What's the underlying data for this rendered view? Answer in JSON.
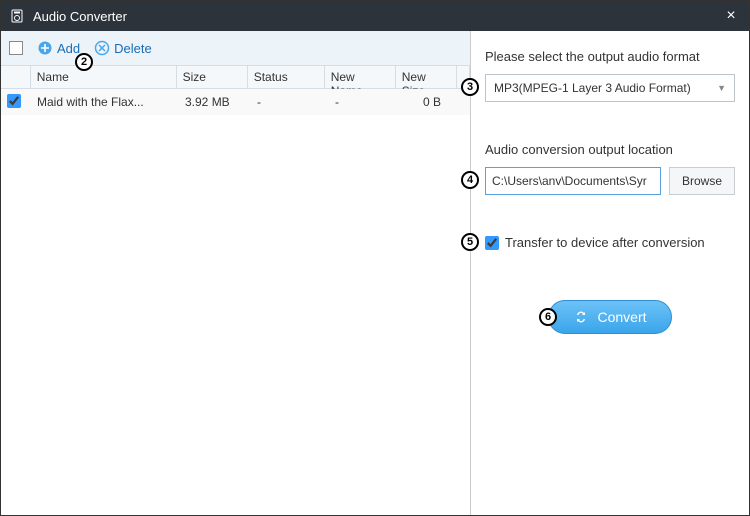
{
  "app": {
    "title": "Audio Converter"
  },
  "toolbar": {
    "add": "Add",
    "delete": "Delete"
  },
  "table": {
    "headers": {
      "name": "Name",
      "size": "Size",
      "status": "Status",
      "newname": "New Name",
      "newsize": "New Size"
    },
    "rows": [
      {
        "checked": true,
        "name": "Maid with the Flax...",
        "size": "3.92 MB",
        "status": "-",
        "newname": "-",
        "newsize": "0 B"
      }
    ]
  },
  "right": {
    "format_label": "Please select the output audio format",
    "format_value": "MP3(MPEG-1 Layer 3 Audio Format)",
    "location_label": "Audio conversion output location",
    "location_value": "C:\\Users\\anv\\Documents\\Syr",
    "browse": "Browse",
    "transfer_label": "Transfer to device after conversion",
    "convert": "Convert"
  },
  "badges": {
    "b2": "2",
    "b3": "3",
    "b4": "4",
    "b5": "5",
    "b6": "6"
  }
}
